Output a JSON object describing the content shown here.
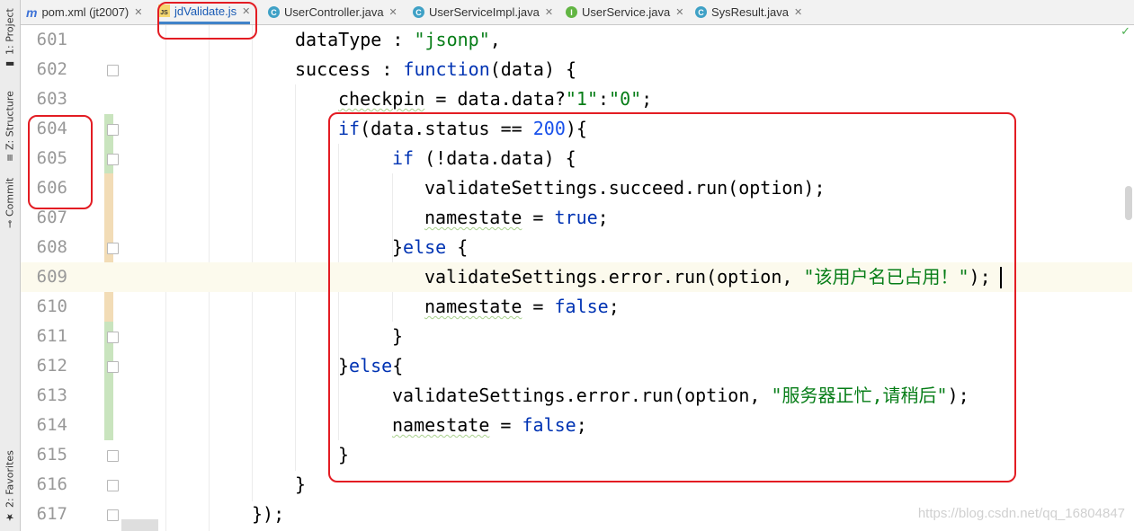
{
  "sidebar": {
    "tools": [
      {
        "label": "1: Project",
        "icon": "folder-icon"
      },
      {
        "label": "Z: Structure",
        "icon": "structure-icon"
      },
      {
        "label": "Commit",
        "icon": "commit-icon"
      },
      {
        "label": "2: Favorites",
        "icon": "star-icon"
      }
    ]
  },
  "tabs": [
    {
      "label": "pom.xml (jt2007)",
      "icon": "maven-icon",
      "active": false
    },
    {
      "label": "jdValidate.js",
      "icon": "javascript-file-icon",
      "active": true
    },
    {
      "label": "UserController.java",
      "icon": "java-class-icon",
      "active": false
    },
    {
      "label": "UserServiceImpl.java",
      "icon": "java-class-icon",
      "active": false
    },
    {
      "label": "UserService.java",
      "icon": "java-interface-icon",
      "active": false
    },
    {
      "label": "SysResult.java",
      "icon": "java-class-icon",
      "active": false
    }
  ],
  "editor": {
    "lines": [
      {
        "n": "601",
        "tokens": [
          {
            "t": "dataType : "
          },
          {
            "t": "\"jsonp\"",
            "c": "str"
          },
          {
            "t": ","
          }
        ]
      },
      {
        "n": "602",
        "tokens": [
          {
            "t": "success : "
          },
          {
            "t": "function",
            "c": "kw"
          },
          {
            "t": "(data) {"
          }
        ]
      },
      {
        "n": "603",
        "tokens": [
          {
            "t": "checkpin",
            "w": 1
          },
          {
            "t": " = data.data?"
          },
          {
            "t": "\"1\"",
            "c": "str"
          },
          {
            "t": ":"
          },
          {
            "t": "\"0\"",
            "c": "str"
          },
          {
            "t": ";"
          }
        ]
      },
      {
        "n": "604",
        "tokens": [
          {
            "t": "if",
            "c": "kw"
          },
          {
            "t": "(data.status == "
          },
          {
            "t": "200",
            "c": "num"
          },
          {
            "t": "){"
          }
        ]
      },
      {
        "n": "605",
        "tokens": [
          {
            "t": "if",
            "c": "kw"
          },
          {
            "t": " (!data.data) {"
          }
        ]
      },
      {
        "n": "606",
        "tokens": [
          {
            "t": "validateSettings.succeed.run(option);"
          }
        ]
      },
      {
        "n": "607",
        "tokens": [
          {
            "t": "namestate",
            "w": 1
          },
          {
            "t": " = "
          },
          {
            "t": "true",
            "c": "kw"
          },
          {
            "t": ";"
          }
        ]
      },
      {
        "n": "608",
        "tokens": [
          {
            "t": "}"
          },
          {
            "t": "else",
            "c": "kw"
          },
          {
            "t": " {"
          }
        ]
      },
      {
        "n": "609",
        "tokens": [
          {
            "t": "validateSettings.error.run(option, "
          },
          {
            "t": "\"该用户名已占用！\"",
            "c": "str"
          },
          {
            "t": ");"
          }
        ]
      },
      {
        "n": "610",
        "tokens": [
          {
            "t": "namestate",
            "w": 1
          },
          {
            "t": " = "
          },
          {
            "t": "false",
            "c": "kw"
          },
          {
            "t": ";"
          }
        ]
      },
      {
        "n": "611",
        "tokens": [
          {
            "t": "}"
          }
        ]
      },
      {
        "n": "612",
        "tokens": [
          {
            "t": "}"
          },
          {
            "t": "else",
            "c": "kw"
          },
          {
            "t": "{"
          }
        ]
      },
      {
        "n": "613",
        "tokens": [
          {
            "t": "validateSettings.error.run(option, "
          },
          {
            "t": "\"服务器正忙,请稍后\"",
            "c": "str"
          },
          {
            "t": ");"
          }
        ]
      },
      {
        "n": "614",
        "tokens": [
          {
            "t": "namestate",
            "w": 1
          },
          {
            "t": " = "
          },
          {
            "t": "false",
            "c": "kw"
          },
          {
            "t": ";"
          }
        ]
      },
      {
        "n": "615",
        "tokens": [
          {
            "t": "}"
          }
        ]
      },
      {
        "n": "616",
        "tokens": [
          {
            "t": "}"
          }
        ]
      },
      {
        "n": "617",
        "tokens": [
          {
            "t": "});"
          }
        ]
      }
    ],
    "current_line": "609",
    "inspection_status": "ok-check-icon"
  },
  "watermark": "https://blog.csdn.net/qq_16804847",
  "colors": {
    "keyword": "#0033b3",
    "number": "#1750eb",
    "string": "#067d17",
    "annotation_red": "#e31c23",
    "changed_green": "#c9e4be",
    "changed_orange": "#f2dcb6"
  }
}
